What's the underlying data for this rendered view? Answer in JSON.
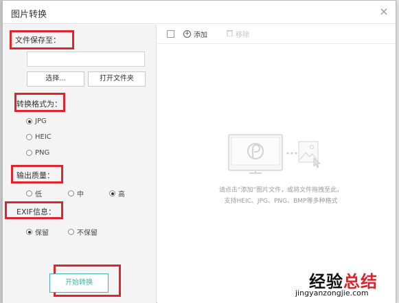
{
  "dialog": {
    "title": "图片转换",
    "close_glyph": "×"
  },
  "save_location": {
    "label": "文件保存至：",
    "path_value": "",
    "choose_button": "选择...",
    "open_folder_button": "打开文件夹"
  },
  "format": {
    "label": "转换格式为：",
    "options": [
      {
        "label": "JPG",
        "checked": true
      },
      {
        "label": "HEIC",
        "checked": false
      },
      {
        "label": "PNG",
        "checked": false
      }
    ]
  },
  "quality": {
    "label": "输出质量：",
    "options": [
      {
        "label": "低",
        "checked": false
      },
      {
        "label": "中",
        "checked": false
      },
      {
        "label": "高",
        "checked": true
      }
    ]
  },
  "exif": {
    "label": "EXIF信息：",
    "options": [
      {
        "label": "保留",
        "checked": true
      },
      {
        "label": "不保留",
        "checked": false
      }
    ]
  },
  "start_button": "开始转换",
  "toolbar": {
    "add_label": "添加",
    "add_icon": "plus-circle-icon",
    "remove_label": "移除",
    "remove_icon": "trash-icon"
  },
  "empty_state": {
    "hint_line1": "请点击“添加”图片文件，或将文件拖拽至此，",
    "hint_line2": "支持HEIC、JPG、PNG、BMP等多种格式"
  },
  "watermark": {
    "part1": "经验",
    "part2": "总结",
    "url": "jingyanzongjie.com"
  },
  "colors": {
    "accent": "#3fb6a2",
    "highlight_box": "#e0242b",
    "watermark_red": "#d6262c"
  }
}
